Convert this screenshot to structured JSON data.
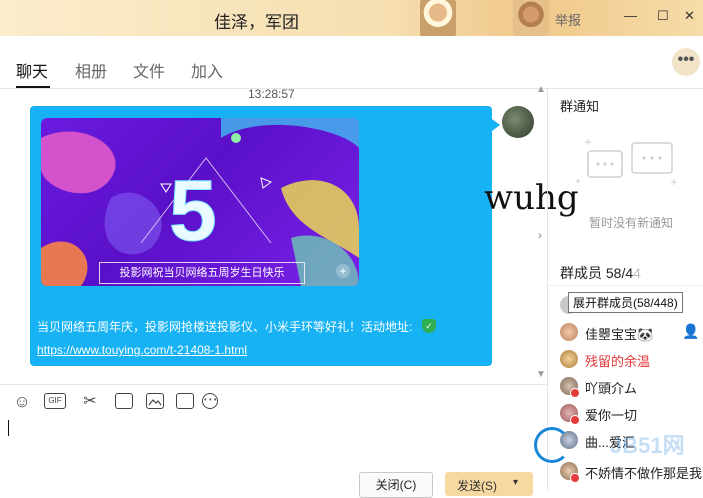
{
  "window": {
    "title": "佳泽，军团",
    "report_label": "举报",
    "minimize": "—",
    "maximize": "☐",
    "close": "✕"
  },
  "tabs": [
    {
      "label": "聊天",
      "active": true
    },
    {
      "label": "相册"
    },
    {
      "label": "文件"
    },
    {
      "label": "加入"
    }
  ],
  "more_label": "•••",
  "chat": {
    "timestamp": "13:28:57",
    "banner_text": "投影网祝当贝网络五周岁生日快乐",
    "banner_big_char": "5",
    "message_text": "当贝网络五周年庆，投影网抢楼送投影仪、小米手环等好礼！活动地址:",
    "message_link": "https://www.touying.com/t-21408-1.html",
    "bubble_color": "#16b2f4"
  },
  "toolbar": {
    "icons": [
      "emoji-icon",
      "gif-icon",
      "scissors-icon",
      "stickers-icon",
      "image-icon",
      "calendar-icon",
      "more-icon"
    ],
    "gif_label": "GIF",
    "emoji_glyph": "☺",
    "scissors_glyph": "✂",
    "more_glyph": "⋯"
  },
  "buttons": {
    "close": "关闭(C)",
    "send": "发送(S)",
    "send_arrow": "▾"
  },
  "notice": {
    "title": "群通知",
    "empty_text": "暂时没有新通知"
  },
  "watermark_text": "wuhg",
  "members": {
    "title": "群成员",
    "count_visible": "58/4",
    "count_faded": "4",
    "expand_tooltip": "展开群成员(58/448)",
    "list": [
      {
        "name": "佳瞾宝宝🐼",
        "color": "#222"
      },
      {
        "name": "残留的余温",
        "color": "#e03a3a"
      },
      {
        "name": "吖頭介ム",
        "color": "#222"
      },
      {
        "name": "爱你一切",
        "color": "#222"
      },
      {
        "name": "曲...爱汇",
        "color": "#222"
      },
      {
        "name": "不娇情不做作那是我",
        "color": "#222"
      }
    ]
  },
  "site_watermark": "JB51网"
}
